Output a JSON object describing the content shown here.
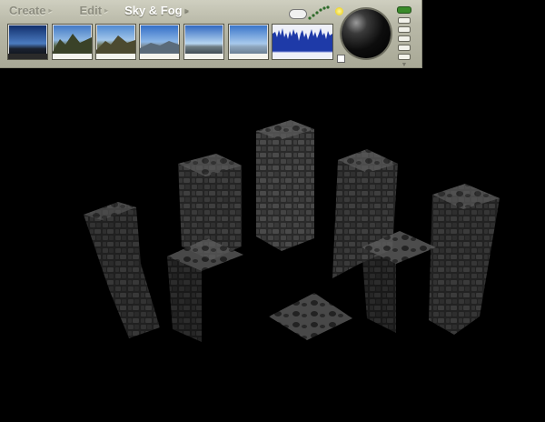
{
  "menu": {
    "create_label": "Create",
    "edit_label": "Edit",
    "sky_fog_label": "Sky & Fog"
  },
  "presets": [
    {
      "name": "sky-preset-1",
      "selected": true
    },
    {
      "name": "sky-preset-2",
      "selected": false
    },
    {
      "name": "sky-preset-3",
      "selected": false
    },
    {
      "name": "sky-preset-4",
      "selected": false
    },
    {
      "name": "sky-preset-5",
      "selected": false
    },
    {
      "name": "sky-preset-6",
      "selected": false
    }
  ],
  "icons": {
    "cloud": "cloud-icon",
    "sun": "sun-icon",
    "dots": "cloud-dots-icon",
    "ball": "sky-preview-ball",
    "memory": "memory-slot-icon"
  },
  "colors": {
    "toolbar_bg": "#b9b9a8",
    "active_menu": "#ffffff",
    "inactive_menu": "#8d8d80",
    "fog_graph": "#1e3aa8",
    "memory_indicator": "#3a8a2a",
    "scene_bg": "#000000"
  }
}
